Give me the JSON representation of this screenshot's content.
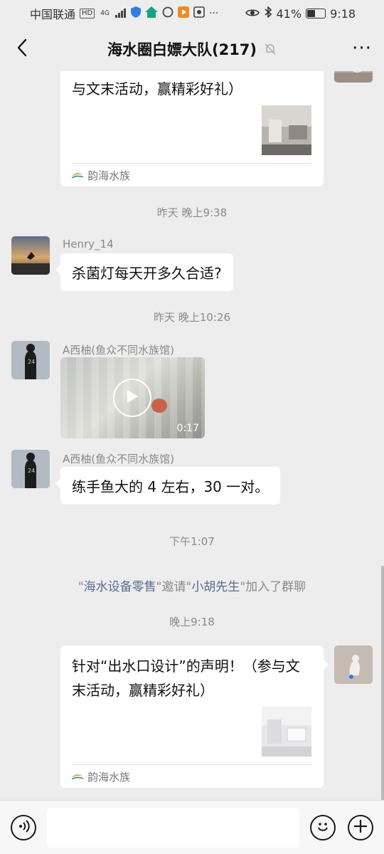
{
  "status_bar": {
    "carrier": "中国联通",
    "hd_badge": "HD",
    "net_badge": "4G",
    "battery_text": "41%",
    "battery_level": 0.41,
    "time": "9:18",
    "icons": [
      "signal-icon",
      "shield-icon",
      "app-icon",
      "sync-icon",
      "play-store-icon",
      "camera-app-icon",
      "more-dots-icon",
      "eye-icon",
      "bluetooth-icon",
      "battery-icon"
    ]
  },
  "header": {
    "title": "海水圈白嫖大队(217)",
    "back_icon": "chevron-left-icon",
    "mute_icon": "bell-off-icon",
    "more_icon": "more-horizontal-icon",
    "more_label": "···"
  },
  "messages": {
    "card_top": {
      "title": "与文末活动，赢精彩好礼）",
      "source": "韵海水族"
    },
    "time1": "昨天 晚上9:38",
    "henry": {
      "sender": "Henry_14",
      "text": "杀菌灯每天开多久合适?"
    },
    "time2": "昨天 晚上10:26",
    "video_msg": {
      "sender": "A西柚(鱼众不同水族馆)",
      "duration": "0:17"
    },
    "text_msg": {
      "sender": "A西柚(鱼众不同水族馆)",
      "text": "练手鱼大的 4 左右，30 一对。"
    },
    "time3": "下午1:07",
    "system": {
      "q1": "\"",
      "inviter": "海水设备零售",
      "q2": "\"邀请\"",
      "invitee": "小胡先生",
      "q3": "\"加入了群聊"
    },
    "time4": "晚上9:18",
    "card_bottom": {
      "title": "针对“出水口设计”的声明！（参与文末活动，赢精彩好礼）",
      "source": "韵海水族"
    }
  },
  "input_bar": {
    "voice_icon": "voice-icon",
    "value": "",
    "emoji_icon": "emoji-icon",
    "plus_icon": "plus-icon"
  },
  "colors": {
    "background": "#ededed",
    "bubble": "#ffffff",
    "link": "#576b95",
    "muted_text": "#8a8a8a"
  }
}
